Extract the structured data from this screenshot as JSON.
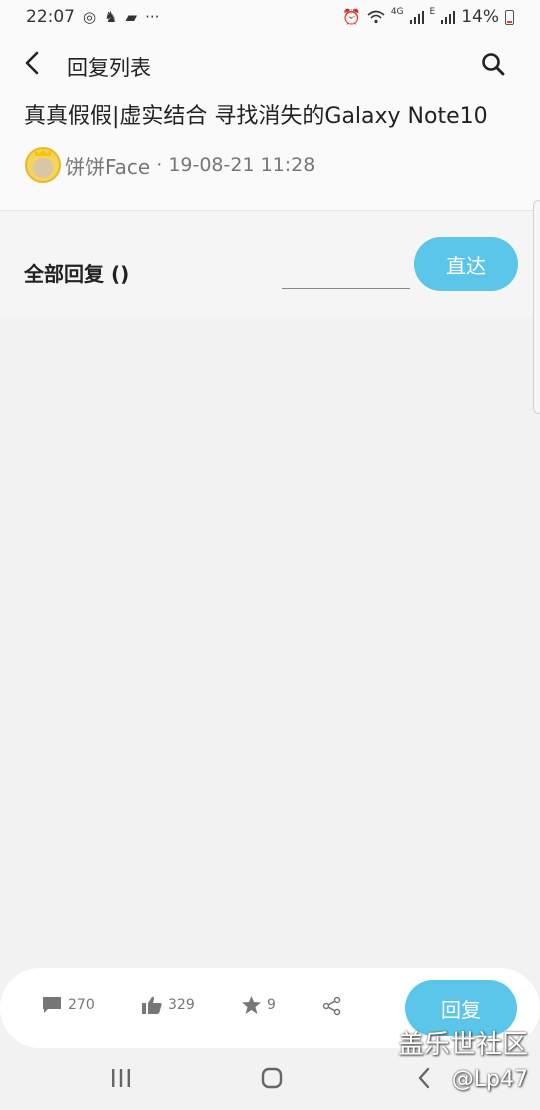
{
  "status_bar": {
    "time": "22:07",
    "battery": "14%",
    "network_label": "4G",
    "network_label2": "E"
  },
  "header": {
    "title": "回复列表",
    "post_title": "真真假假|虚实结合 寻找消失的Galaxy Note10",
    "author": "饼饼Face",
    "time": "· 19-08-21 11:28"
  },
  "jump_bar": {
    "all_replies_label": "全部回复 ()",
    "page_input_value": "",
    "goto_label": "直达"
  },
  "bottom_bar": {
    "comments": "270",
    "likes": "329",
    "favorites": "9",
    "reply_label": "回复"
  },
  "watermark": {
    "site": "盖乐世社区",
    "user": "@Lp47"
  },
  "colors": {
    "accent": "#5bc6ea",
    "background": "#f2f2f2"
  }
}
